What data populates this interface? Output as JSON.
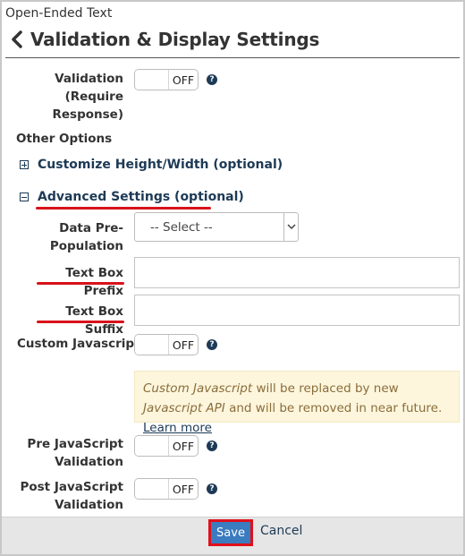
{
  "panel": {
    "label": "Open-Ended Text",
    "title": "Validation & Display Settings"
  },
  "validation": {
    "label": "Validation (Require Response)",
    "toggle": "OFF",
    "help": "?"
  },
  "other_options": {
    "heading": "Other Options"
  },
  "customize": {
    "label": "Customize Height/Width (optional)",
    "expanded": false
  },
  "advanced": {
    "label": "Advanced Settings (optional)",
    "expanded": true
  },
  "data_prepopulation": {
    "label": "Data Pre-Population",
    "selected": "-- Select --"
  },
  "text_box_prefix": {
    "label": "Text Box Prefix",
    "value": ""
  },
  "text_box_suffix": {
    "label": "Text Box Suffix",
    "value": ""
  },
  "custom_javascript": {
    "label": "Custom Javascript",
    "toggle": "OFF",
    "help": "?"
  },
  "notice": {
    "part1": "Custom Javascript",
    "part2": " will be replaced by new ",
    "part3": "Javascript API",
    "part4": " and will be removed in near future. ",
    "link": "Learn more"
  },
  "pre_js_validation": {
    "label": "Pre JavaScript Validation",
    "toggle": "OFF",
    "help": "?"
  },
  "post_js_validation": {
    "label": "Post JavaScript Validation",
    "toggle": "OFF",
    "help": "?"
  },
  "footer": {
    "save": "Save",
    "cancel": "Cancel"
  },
  "colors": {
    "accent": "#1d3a56",
    "highlight": "#d8121b",
    "save_button": "#3b7bbf",
    "notice_bg": "#fdf6dd"
  },
  "icons": {
    "back": "chevron-left-icon",
    "expand": "plus-square-icon",
    "collapse": "minus-square-icon",
    "help": "question-circle-icon",
    "dropdown": "chevron-down-icon"
  }
}
